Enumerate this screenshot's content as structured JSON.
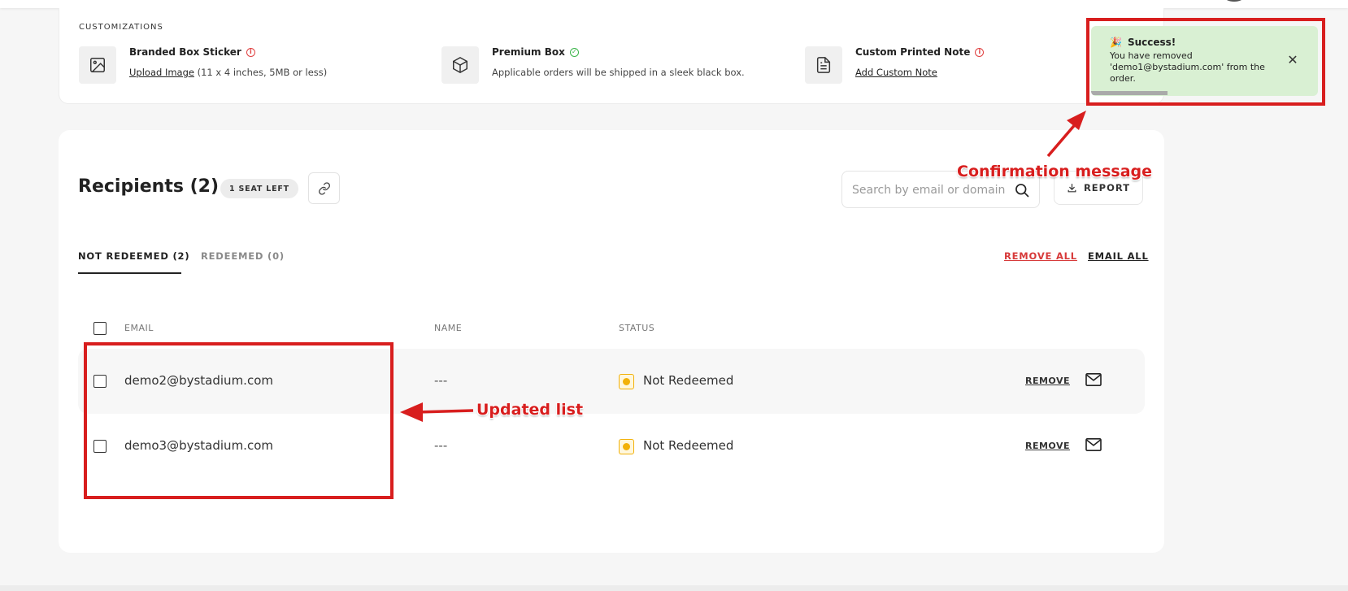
{
  "customizations": {
    "heading": "CUSTOMIZATIONS",
    "items": [
      {
        "title": "Branded Box Sticker",
        "link": "Upload Image",
        "desc": " (11 x 4 inches, 5MB or less)",
        "icon": "image-icon",
        "status_icon": "info-icon"
      },
      {
        "title": "Premium Box",
        "desc": "Applicable orders will be shipped in a sleek black box.",
        "icon": "box-icon",
        "status_icon": "check-circle-icon"
      },
      {
        "title": "Custom Printed Note",
        "link": "Add Custom Note",
        "icon": "document-icon",
        "status_icon": "info-icon"
      }
    ]
  },
  "recipients": {
    "title": "Recipients (2)",
    "seat_badge": "1 SEAT LEFT",
    "search_placeholder": "Search by email or domain",
    "report_label": "REPORT",
    "tabs": [
      {
        "label": "NOT REDEEMED (2)",
        "active": true
      },
      {
        "label": "REDEEMED (0)",
        "active": false
      }
    ],
    "remove_all": "REMOVE ALL",
    "email_all": "EMAIL ALL",
    "columns": {
      "email": "EMAIL",
      "name": "NAME",
      "status": "STATUS"
    },
    "rows": [
      {
        "email": "demo2@bystadium.com",
        "name": "---",
        "status": "Not Redeemed",
        "remove": "REMOVE"
      },
      {
        "email": "demo3@bystadium.com",
        "name": "---",
        "status": "Not Redeemed",
        "remove": "REMOVE"
      }
    ]
  },
  "toast": {
    "icon": "🎉",
    "title": "Success!",
    "message": "You have removed 'demo1@bystadium.com' from the order.",
    "close": "✕"
  },
  "annotations": {
    "confirmation": "Confirmation message",
    "updated_list": "Updated list"
  },
  "colors": {
    "accent_red": "#d81e1e",
    "remove_all_red": "#d73a3a",
    "toast_green": "#d9f0d3",
    "status_yellow": "#f2b10a"
  }
}
